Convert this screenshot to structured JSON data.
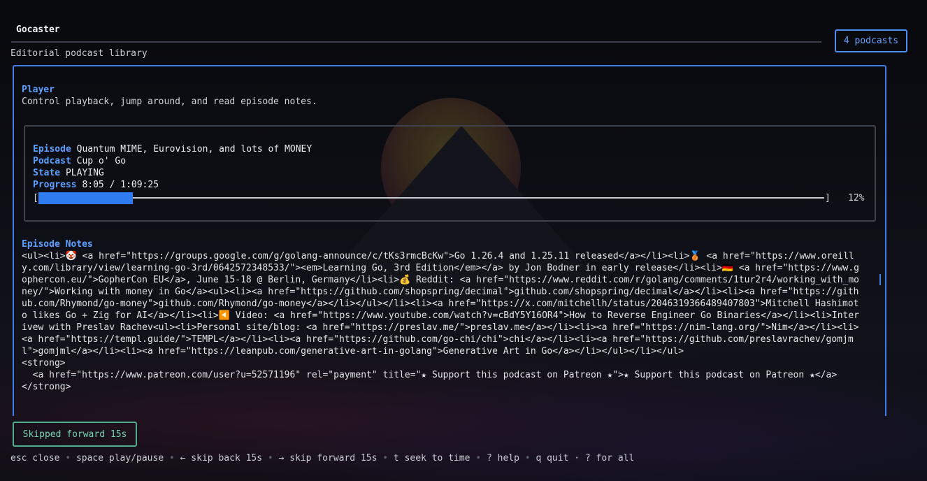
{
  "app": {
    "title": "Gocaster",
    "subtitle": "Editorial podcast library",
    "podcast_count": "4 podcasts"
  },
  "player": {
    "title": "Player",
    "description": "Control playback, jump around, and read episode notes.",
    "episode_label": "Episode",
    "episode_value": "Quantum MIME, Eurovision, and lots of MONEY",
    "podcast_label": "Podcast",
    "podcast_value": "Cup o' Go",
    "state_label": "State",
    "state_value": "PLAYING",
    "progress_label": "Progress",
    "progress_value": "8:05 / 1:09:25",
    "progress_fraction": 0.12,
    "progress_percent": "12%",
    "bracket_left": "[",
    "bracket_right": "]"
  },
  "notes": {
    "title": "Episode Notes",
    "body": "<ul><li>🤡 <a href=\"https://groups.google.com/g/golang-announce/c/tKs3rmcBcKw\">Go 1.26.4 and 1.25.11 released</a></li><li>🥉 <a href=\"https://www.oreilly.com/library/view/learning-go-3rd/0642572348533/\"><em>Learning Go, 3rd Edition</em></a> by Jon Bodner in early release</li><li>🇩🇪 <a href=\"https://www.gophercon.eu/\">GopherCon EU</a>, June 15-18 @ Berlin, Germany</li><li>💰 Reddit: <a href=\"https://www.reddit.com/r/golang/comments/1tur2r4/working_with_money/\">Working with money in Go</a><ul><li><a href=\"https://github.com/shopspring/decimal\">github.com/shopspring/decimal</a></li><li><a href=\"https://github.com/Rhymond/go-money\">github.com/Rhymond/go-money</a></li></ul></li><li><a href=\"https://x.com/mitchellh/status/2046319366489407803\">Mitchell Hashimoto likes Go + Zig for AI</a></li><li>◀️ Video: <a href=\"https://www.youtube.com/watch?v=cBdY5Y16OR4\">How to Reverse Engineer Go Binaries</a></li><li>Interivew with Preslav Rachev<ul><li>Personal site/blog: <a href=\"https://preslav.me/\">preslav.me</a></li><li><a href=\"https://nim-lang.org/\">Nim</a></li><li><a href=\"https://templ.guide/\">TEMPL</a></li><li><a href=\"https://github.com/go-chi/chi\">chi</a></li><li><a href=\"https://github.com/preslavrachev/gomjml\">gomjml</a></li><li><a href=\"https://leanpub.com/generative-art-in-golang\">Generative Art in Go</a></li></ul></li></ul>\n<strong>\n  <a href=\"https://www.patreon.com/user?u=52571196\" rel=\"payment\" title=\"★ Support this podcast on Patreon ★\">★ Support this podcast on Patreon ★</a>\n</strong>"
  },
  "toast": {
    "text": "Skipped forward 15s"
  },
  "help": {
    "items": [
      "esc close",
      "space play/pause",
      "← skip back 15s",
      "→ skip forward 15s",
      "t seek to time",
      "? help",
      "q quit · ? for all"
    ],
    "separator": "•"
  },
  "colors": {
    "accent": "#5aa1ff",
    "panel_border": "#3b7fe6",
    "progress_fill": "#2f7cf0",
    "toast_border": "#4fae8e",
    "toast_text": "#6fd6ad"
  }
}
